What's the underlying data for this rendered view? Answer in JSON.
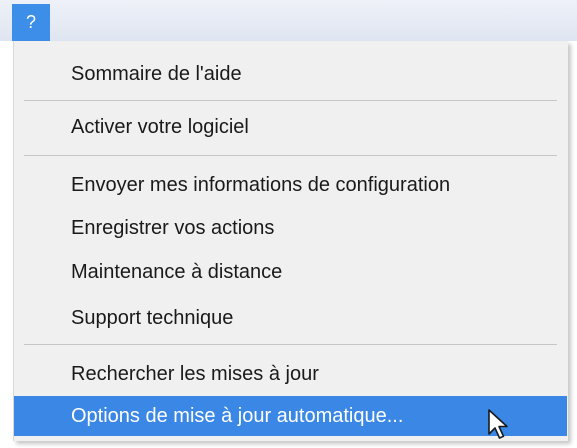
{
  "menubar": {
    "title": "?"
  },
  "menu": {
    "items": [
      {
        "label": "Sommaire de l'aide"
      },
      {
        "label": "Activer votre logiciel"
      },
      {
        "label": "Envoyer mes informations de configuration"
      },
      {
        "label": "Enregistrer vos actions"
      },
      {
        "label": "Maintenance à distance"
      },
      {
        "label": "Support technique"
      },
      {
        "label": "Rechercher les mises à jour"
      },
      {
        "label": "Options de mise à jour automatique..."
      }
    ],
    "highlighted_index": 7
  },
  "colors": {
    "highlight": "#3a87e6",
    "menu_bg": "#f0f0f0",
    "menubar_item": "#3d8ee8"
  },
  "icons": {
    "cursor": "mouse-pointer-icon"
  }
}
